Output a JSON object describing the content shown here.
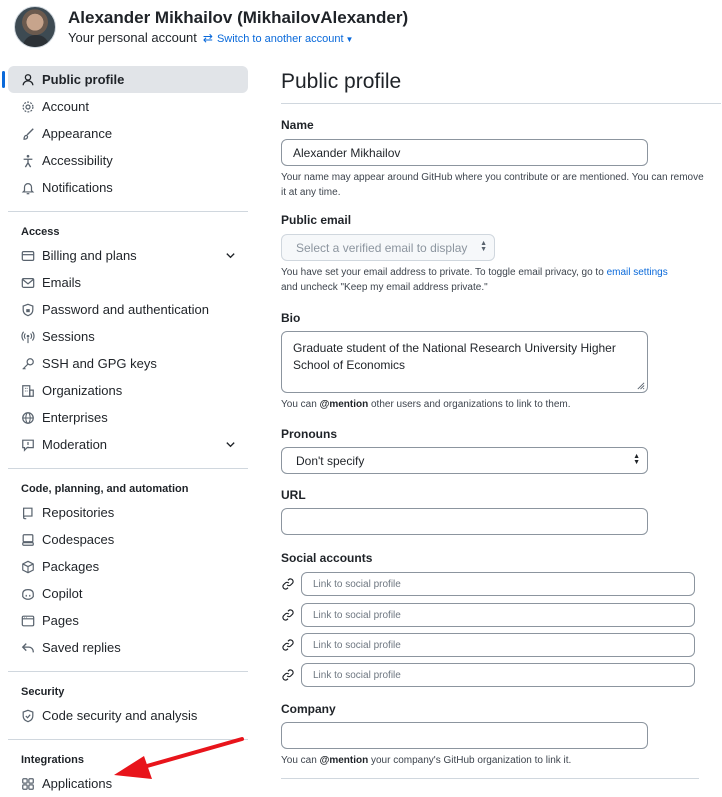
{
  "header": {
    "user_name": "Alexander Mikhailov (MikhailovAlexander)",
    "account_type": "Your personal account",
    "switch_label": "Switch to another account"
  },
  "sidebar": {
    "top_items": [
      {
        "label": "Public profile",
        "icon": "person-icon",
        "active": true
      },
      {
        "label": "Account",
        "icon": "gear-icon"
      },
      {
        "label": "Appearance",
        "icon": "paintbrush-icon"
      },
      {
        "label": "Accessibility",
        "icon": "accessibility-icon"
      },
      {
        "label": "Notifications",
        "icon": "bell-icon"
      }
    ],
    "access": {
      "title": "Access",
      "items": [
        {
          "label": "Billing and plans",
          "icon": "credit-card-icon",
          "expandable": true
        },
        {
          "label": "Emails",
          "icon": "mail-icon"
        },
        {
          "label": "Password and authentication",
          "icon": "shield-lock-icon"
        },
        {
          "label": "Sessions",
          "icon": "broadcast-icon"
        },
        {
          "label": "SSH and GPG keys",
          "icon": "key-icon"
        },
        {
          "label": "Organizations",
          "icon": "organization-icon"
        },
        {
          "label": "Enterprises",
          "icon": "globe-icon"
        },
        {
          "label": "Moderation",
          "icon": "report-icon",
          "expandable": true
        }
      ]
    },
    "code": {
      "title": "Code, planning, and automation",
      "items": [
        {
          "label": "Repositories",
          "icon": "repo-icon"
        },
        {
          "label": "Codespaces",
          "icon": "codespaces-icon"
        },
        {
          "label": "Packages",
          "icon": "package-icon"
        },
        {
          "label": "Copilot",
          "icon": "copilot-icon"
        },
        {
          "label": "Pages",
          "icon": "browser-icon"
        },
        {
          "label": "Saved replies",
          "icon": "reply-icon"
        }
      ]
    },
    "security": {
      "title": "Security",
      "items": [
        {
          "label": "Code security and analysis",
          "icon": "shield-check-icon"
        }
      ]
    },
    "integrations": {
      "title": "Integrations",
      "items": [
        {
          "label": "Applications",
          "icon": "apps-icon"
        }
      ]
    }
  },
  "main": {
    "title": "Public profile",
    "name": {
      "label": "Name",
      "value": "Alexander Mikhailov",
      "note": "Your name may appear around GitHub where you contribute or are mentioned. You can remove it at any time."
    },
    "public_email": {
      "label": "Public email",
      "placeholder": "Select a verified email to display",
      "note_before": "You have set your email address to private. To toggle email privacy, go to ",
      "note_link": "email settings",
      "note_after": "and uncheck \"Keep my email address private.\""
    },
    "bio": {
      "label": "Bio",
      "value": "Graduate student of the National Research University Higher School of Economics",
      "note_before": "You can ",
      "note_mention": "@mention",
      "note_after": " other users and organizations to link to them."
    },
    "pronouns": {
      "label": "Pronouns",
      "value": "Don't specify"
    },
    "url": {
      "label": "URL",
      "value": ""
    },
    "social": {
      "label": "Social accounts",
      "placeholder": "Link to social profile"
    },
    "company": {
      "label": "Company",
      "value": "",
      "note_before": "You can ",
      "note_mention": "@mention",
      "note_after": " your company's GitHub organization to link it."
    }
  },
  "colors": {
    "accent": "#0969da",
    "annotation_arrow": "#e8141b"
  }
}
